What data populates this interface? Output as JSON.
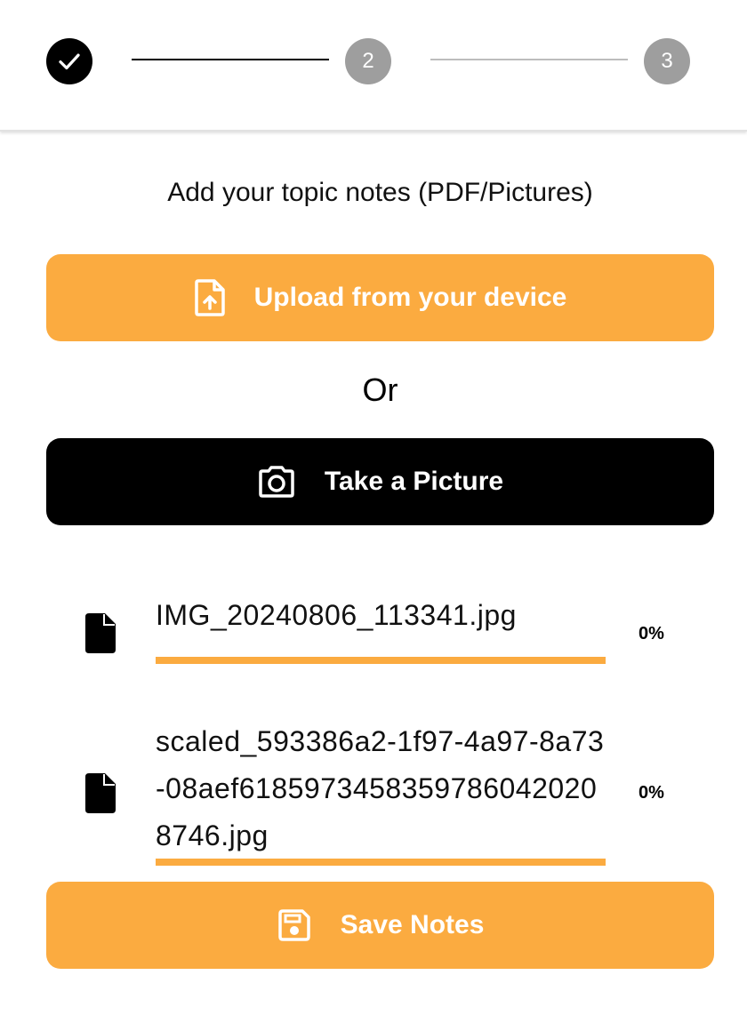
{
  "stepper": {
    "steps": [
      {
        "label": "",
        "state": "completed"
      },
      {
        "label": "2",
        "state": "pending"
      },
      {
        "label": "3",
        "state": "pending"
      }
    ]
  },
  "instruction": "Add your topic notes (PDF/Pictures)",
  "upload_button": {
    "label": "Upload from your device",
    "icon": "file-upload-icon"
  },
  "or_text": "Or",
  "camera_button": {
    "label": "Take a Picture",
    "icon": "camera-icon"
  },
  "files": [
    {
      "name": "IMG_20240806_113341.jpg",
      "progress": "0%",
      "icon": "file-icon"
    },
    {
      "name": "scaled_593386a2-1f97-4a97-8a73-08aef61859734583597860420208746.jpg",
      "progress": "0%",
      "icon": "file-icon"
    }
  ],
  "save_button": {
    "label": "Save Notes",
    "icon": "save-icon"
  },
  "colors": {
    "accent": "#fbab40",
    "dark": "#000000",
    "inactive_step": "#9e9e9e"
  }
}
